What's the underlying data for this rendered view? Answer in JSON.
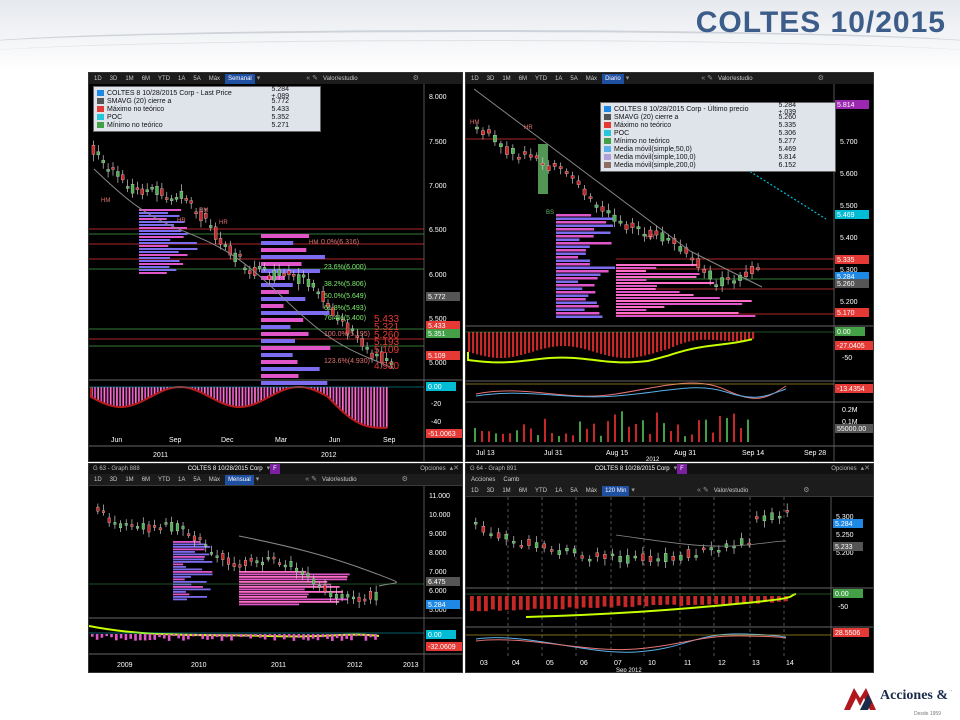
{
  "slide": {
    "title": "COLTES 10/2015",
    "logo_text": "Acciones & Valores",
    "logo_subtext": "Desde 1959"
  },
  "toolbar_buttons": [
    "1D",
    "3D",
    "1M",
    "6M",
    "YTD",
    "1A",
    "5A",
    "Máx"
  ],
  "panels": {
    "weekly": {
      "period": "Semanal",
      "study_label": "Valor/estudio",
      "legend": [
        {
          "name": "COLTES 8 10/28/2015 Corp - Last Price",
          "value": "5.284  +.089",
          "color": "#1e88e5"
        },
        {
          "name": "SMAVG (20) cierre a",
          "value": "5.772",
          "color": "#555555"
        },
        {
          "name": "Máximo no teórico",
          "value": "5.433",
          "color": "#e53935"
        },
        {
          "name": "POC",
          "value": "5.352",
          "color": "#26c6da"
        },
        {
          "name": "Mínimo no teórico",
          "value": "5.271",
          "color": "#43a047"
        }
      ],
      "y_ticks": [
        "8.000",
        "7.500",
        "7.000",
        "6.500",
        "6.000",
        "5.500",
        "5.000"
      ],
      "x_ticks": [
        "Jun",
        "Sep",
        "Dec",
        "Mar",
        "Jun",
        "Sep"
      ],
      "x_years": [
        "2011",
        "2012"
      ],
      "fib_labels": [
        "0.0%(6.316)",
        "23.6%(6.000)",
        "38.2%(5.806)",
        "50.0%(5.649)",
        "61.8%(5.493)",
        "76.4%(5.400)",
        "100.0%(5.195)",
        "123.6%(4.930)"
      ],
      "hm_labels": [
        "HM",
        "HR",
        "HM",
        "HR",
        "HM"
      ],
      "price_tags": [
        {
          "text": "5.772",
          "color": "#555555"
        },
        {
          "text": "5.433",
          "color": "#e53935"
        },
        {
          "text": "5.351",
          "color": "#43a047"
        },
        {
          "text": "5.109",
          "color": "#e53935"
        }
      ],
      "red_values": [
        "5.433",
        "5.321",
        "5.260",
        "5.193",
        "5.109",
        "4.930"
      ],
      "osc_ticks": [
        "0",
        "-20",
        "-40"
      ],
      "osc_tags": [
        {
          "text": "0.00",
          "color": "#00bcd4"
        },
        {
          "text": "-51.0063",
          "color": "#e53935"
        }
      ]
    },
    "daily": {
      "period": "Diario",
      "study_label": "Valor/estudio",
      "legend": [
        {
          "name": "COLTES 8 10/28/2015 Corp - Último precio",
          "value": "5.284 +.039",
          "color": "#1e88e5"
        },
        {
          "name": "SMAVG (20) cierre a",
          "value": "5.260",
          "color": "#555555"
        },
        {
          "name": "Máximo no teórico",
          "value": "5.335",
          "color": "#e53935"
        },
        {
          "name": "POC",
          "value": "5.306",
          "color": "#26c6da"
        },
        {
          "name": "Mínimo no teórico",
          "value": "5.277",
          "color": "#43a047"
        },
        {
          "name": "Media móvil(simple,50,0)",
          "value": "5.469",
          "color": "#5ab0e8"
        },
        {
          "name": "Media móvil(simple,100,0)",
          "value": "5.814",
          "color": "#b0a0d8"
        },
        {
          "name": "Media móvil(simple,200,0)",
          "value": "6.152",
          "color": "#8d6e63"
        }
      ],
      "y_ticks": [
        "5.700",
        "5.600",
        "5.500",
        "5.400",
        "5.300",
        "5.200"
      ],
      "x_ticks": [
        "Jul 13",
        "Jul 31",
        "Aug 15",
        "Aug 31",
        "Sep 14",
        "Sep 28"
      ],
      "x_year": "2012",
      "price_tags": [
        {
          "text": "5.814",
          "color": "#9c27b0"
        },
        {
          "text": "5.469",
          "color": "#00bcd4"
        },
        {
          "text": "5.335",
          "color": "#e53935"
        },
        {
          "text": "5.284",
          "color": "#1e88e5"
        },
        {
          "text": "5.260",
          "color": "#555555"
        },
        {
          "text": "5.170",
          "color": "#e53935"
        }
      ],
      "labels": [
        "HM",
        "HR",
        "BS",
        "HR"
      ],
      "osc_ticks": [
        "0",
        "-50"
      ],
      "osc_tags": [
        {
          "text": "0.00",
          "color": "#43a047"
        },
        {
          "text": "-27.0405",
          "color": "#e53935"
        }
      ],
      "osc2_tags": [
        {
          "text": "-13.4354",
          "color": "#e53935"
        }
      ],
      "vol_ticks": [
        "0.2M",
        "0.1M"
      ],
      "vol_tag": "55000.00"
    },
    "monthly": {
      "window_title": "G 63 - Graph 888",
      "security": "COLTES 8 10/28/2015 Corp",
      "options": "Opciones",
      "period": "Mensual",
      "study_label": "Valor/estudio",
      "y_ticks": [
        "11.000",
        "10.000",
        "9.000",
        "8.000",
        "7.000",
        "6.000",
        "5.000"
      ],
      "x_ticks": [
        "2009",
        "2010",
        "2011",
        "2012",
        "2013"
      ],
      "price_tags": [
        {
          "text": "6.475",
          "color": "#555555"
        },
        {
          "text": "5.284",
          "color": "#1e88e5"
        }
      ],
      "osc_tags": [
        {
          "text": "0.00",
          "color": "#00bcd4"
        },
        {
          "text": "-32.0609",
          "color": "#e53935"
        }
      ]
    },
    "intraday": {
      "window_title": "G 64 - Graph 891",
      "security": "COLTES 8 10/28/2015 Corp",
      "options": "Opciones",
      "tabs": [
        "Acciones",
        "Camb"
      ],
      "period": "120 Min",
      "study_label": "Valor/estudio",
      "y_ticks": [
        "5.300",
        "5.250",
        "5.200"
      ],
      "x_ticks": [
        "03",
        "04",
        "05",
        "06",
        "07",
        "10",
        "11",
        "12",
        "13",
        "14"
      ],
      "x_month": "Sep 2012",
      "price_tags": [
        {
          "text": "5.284",
          "color": "#1e88e5"
        },
        {
          "text": "5.233",
          "color": "#555555"
        }
      ],
      "osc_ticks": [
        "0",
        "-50"
      ],
      "osc_tags": [
        {
          "text": "0.00",
          "color": "#43a047"
        },
        {
          "text": "28.5506",
          "color": "#e53935"
        }
      ]
    }
  }
}
